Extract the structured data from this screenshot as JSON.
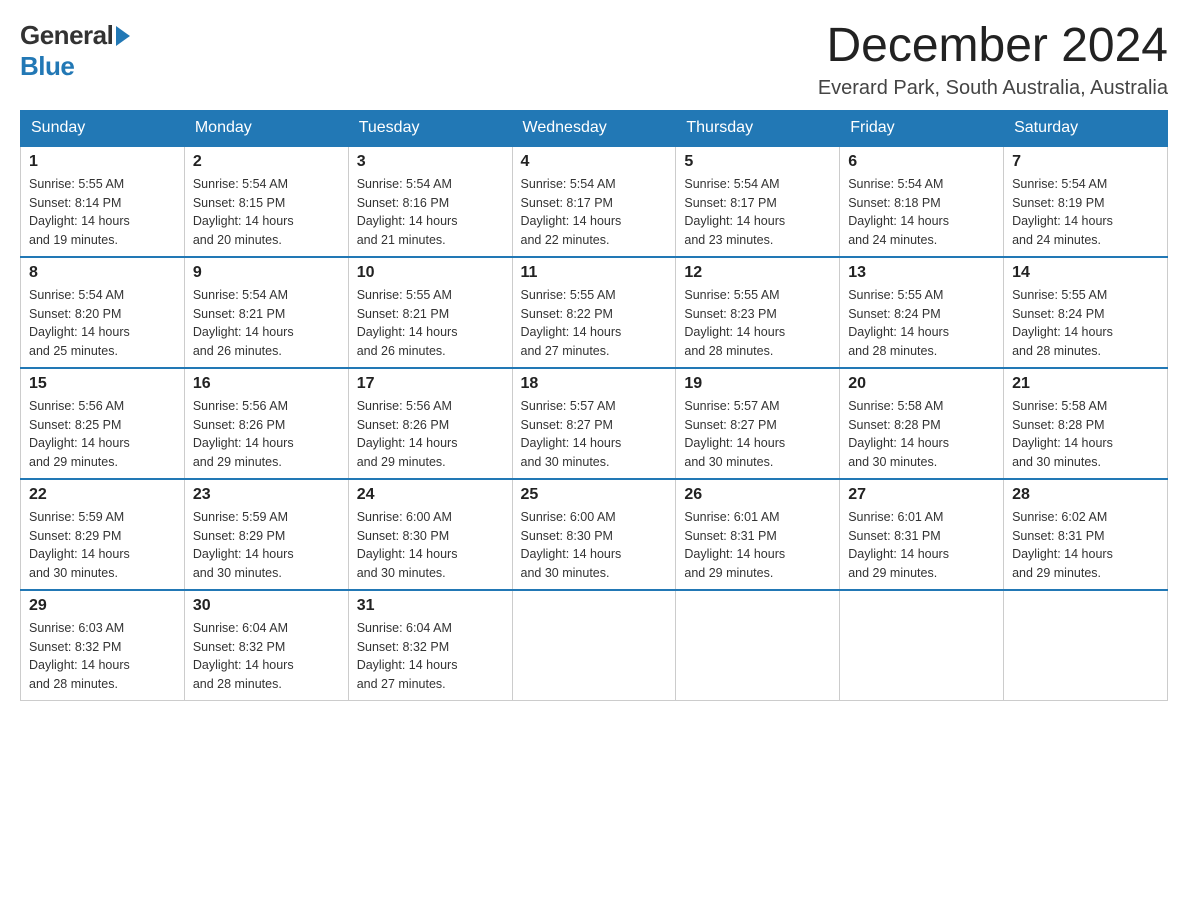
{
  "header": {
    "logo_general": "General",
    "logo_blue": "Blue",
    "month_title": "December 2024",
    "subtitle": "Everard Park, South Australia, Australia"
  },
  "weekdays": [
    "Sunday",
    "Monday",
    "Tuesday",
    "Wednesday",
    "Thursday",
    "Friday",
    "Saturday"
  ],
  "weeks": [
    [
      {
        "day": "1",
        "sunrise": "5:55 AM",
        "sunset": "8:14 PM",
        "daylight": "14 hours and 19 minutes."
      },
      {
        "day": "2",
        "sunrise": "5:54 AM",
        "sunset": "8:15 PM",
        "daylight": "14 hours and 20 minutes."
      },
      {
        "day": "3",
        "sunrise": "5:54 AM",
        "sunset": "8:16 PM",
        "daylight": "14 hours and 21 minutes."
      },
      {
        "day": "4",
        "sunrise": "5:54 AM",
        "sunset": "8:17 PM",
        "daylight": "14 hours and 22 minutes."
      },
      {
        "day": "5",
        "sunrise": "5:54 AM",
        "sunset": "8:17 PM",
        "daylight": "14 hours and 23 minutes."
      },
      {
        "day": "6",
        "sunrise": "5:54 AM",
        "sunset": "8:18 PM",
        "daylight": "14 hours and 24 minutes."
      },
      {
        "day": "7",
        "sunrise": "5:54 AM",
        "sunset": "8:19 PM",
        "daylight": "14 hours and 24 minutes."
      }
    ],
    [
      {
        "day": "8",
        "sunrise": "5:54 AM",
        "sunset": "8:20 PM",
        "daylight": "14 hours and 25 minutes."
      },
      {
        "day": "9",
        "sunrise": "5:54 AM",
        "sunset": "8:21 PM",
        "daylight": "14 hours and 26 minutes."
      },
      {
        "day": "10",
        "sunrise": "5:55 AM",
        "sunset": "8:21 PM",
        "daylight": "14 hours and 26 minutes."
      },
      {
        "day": "11",
        "sunrise": "5:55 AM",
        "sunset": "8:22 PM",
        "daylight": "14 hours and 27 minutes."
      },
      {
        "day": "12",
        "sunrise": "5:55 AM",
        "sunset": "8:23 PM",
        "daylight": "14 hours and 28 minutes."
      },
      {
        "day": "13",
        "sunrise": "5:55 AM",
        "sunset": "8:24 PM",
        "daylight": "14 hours and 28 minutes."
      },
      {
        "day": "14",
        "sunrise": "5:55 AM",
        "sunset": "8:24 PM",
        "daylight": "14 hours and 28 minutes."
      }
    ],
    [
      {
        "day": "15",
        "sunrise": "5:56 AM",
        "sunset": "8:25 PM",
        "daylight": "14 hours and 29 minutes."
      },
      {
        "day": "16",
        "sunrise": "5:56 AM",
        "sunset": "8:26 PM",
        "daylight": "14 hours and 29 minutes."
      },
      {
        "day": "17",
        "sunrise": "5:56 AM",
        "sunset": "8:26 PM",
        "daylight": "14 hours and 29 minutes."
      },
      {
        "day": "18",
        "sunrise": "5:57 AM",
        "sunset": "8:27 PM",
        "daylight": "14 hours and 30 minutes."
      },
      {
        "day": "19",
        "sunrise": "5:57 AM",
        "sunset": "8:27 PM",
        "daylight": "14 hours and 30 minutes."
      },
      {
        "day": "20",
        "sunrise": "5:58 AM",
        "sunset": "8:28 PM",
        "daylight": "14 hours and 30 minutes."
      },
      {
        "day": "21",
        "sunrise": "5:58 AM",
        "sunset": "8:28 PM",
        "daylight": "14 hours and 30 minutes."
      }
    ],
    [
      {
        "day": "22",
        "sunrise": "5:59 AM",
        "sunset": "8:29 PM",
        "daylight": "14 hours and 30 minutes."
      },
      {
        "day": "23",
        "sunrise": "5:59 AM",
        "sunset": "8:29 PM",
        "daylight": "14 hours and 30 minutes."
      },
      {
        "day": "24",
        "sunrise": "6:00 AM",
        "sunset": "8:30 PM",
        "daylight": "14 hours and 30 minutes."
      },
      {
        "day": "25",
        "sunrise": "6:00 AM",
        "sunset": "8:30 PM",
        "daylight": "14 hours and 30 minutes."
      },
      {
        "day": "26",
        "sunrise": "6:01 AM",
        "sunset": "8:31 PM",
        "daylight": "14 hours and 29 minutes."
      },
      {
        "day": "27",
        "sunrise": "6:01 AM",
        "sunset": "8:31 PM",
        "daylight": "14 hours and 29 minutes."
      },
      {
        "day": "28",
        "sunrise": "6:02 AM",
        "sunset": "8:31 PM",
        "daylight": "14 hours and 29 minutes."
      }
    ],
    [
      {
        "day": "29",
        "sunrise": "6:03 AM",
        "sunset": "8:32 PM",
        "daylight": "14 hours and 28 minutes."
      },
      {
        "day": "30",
        "sunrise": "6:04 AM",
        "sunset": "8:32 PM",
        "daylight": "14 hours and 28 minutes."
      },
      {
        "day": "31",
        "sunrise": "6:04 AM",
        "sunset": "8:32 PM",
        "daylight": "14 hours and 27 minutes."
      },
      null,
      null,
      null,
      null
    ]
  ],
  "labels": {
    "sunrise": "Sunrise:",
    "sunset": "Sunset:",
    "daylight": "Daylight:"
  }
}
